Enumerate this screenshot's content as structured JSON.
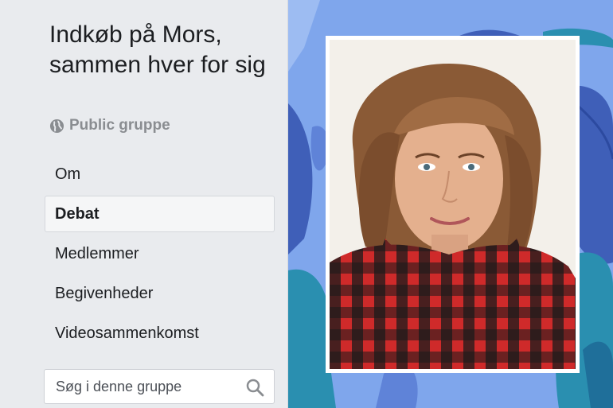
{
  "group": {
    "title": "Indkøb på Mors, sammen hver for sig",
    "privacy_label": "Public gruppe",
    "privacy_icon": "globe-icon"
  },
  "nav": {
    "items": [
      {
        "label": "Om",
        "active": false
      },
      {
        "label": "Debat",
        "active": true
      },
      {
        "label": "Medlemmer",
        "active": false
      },
      {
        "label": "Begivenheder",
        "active": false
      },
      {
        "label": "Videosammenkomst",
        "active": false
      }
    ]
  },
  "search": {
    "placeholder": "Søg i denne gruppe",
    "icon": "magnifier-icon"
  },
  "cover": {
    "background_color": "#7fa6ec",
    "shape_color_dark": "#3f5fb8",
    "shape_color_teal": "#2a8fb0"
  }
}
